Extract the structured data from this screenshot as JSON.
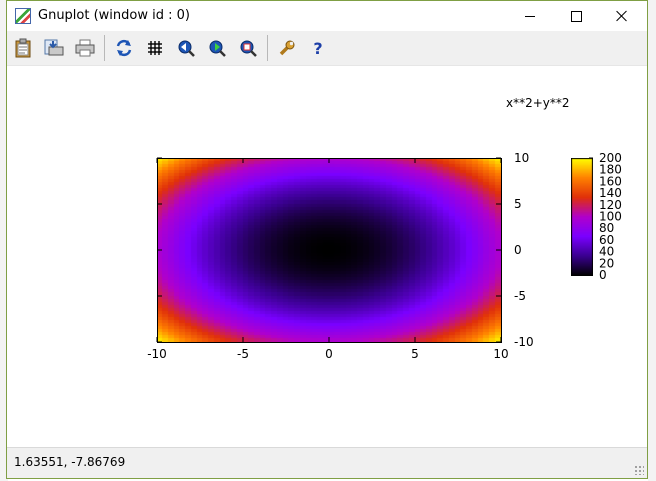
{
  "window": {
    "title": "Gnuplot (window id : 0)"
  },
  "toolbar": {
    "items": [
      {
        "icon": "clipboard-icon"
      },
      {
        "icon": "print-save-icon"
      },
      {
        "icon": "printer-icon"
      },
      {
        "icon": "replot-icon"
      },
      {
        "icon": "grid-icon"
      },
      {
        "icon": "zoom-previous-icon"
      },
      {
        "icon": "zoom-next-icon"
      },
      {
        "icon": "unzoom-icon"
      },
      {
        "icon": "options-wrench-icon"
      },
      {
        "icon": "help-icon"
      }
    ]
  },
  "chart_data": {
    "type": "heatmap",
    "function": "x**2+y**2",
    "title": "x**2+y**2",
    "xlim": [
      -10,
      10
    ],
    "ylim": [
      -10,
      10
    ],
    "x_ticks": [
      "-10",
      "-5",
      "0",
      "5",
      "10"
    ],
    "y_ticks": [
      "10",
      "5",
      "0",
      "-5",
      "-10"
    ],
    "zlim": [
      0,
      200
    ],
    "colorbar_ticks": [
      "200",
      "180",
      "160",
      "140",
      "120",
      "100",
      "80",
      "60",
      "40",
      "20",
      "0"
    ],
    "palette": [
      "#000000",
      "#3a0090",
      "#7a00ff",
      "#b000cc",
      "#e0300a",
      "#ff8000",
      "#ffff00"
    ],
    "legend_position": "right"
  },
  "status": {
    "coordinates": "1.63551, -7.86769"
  }
}
